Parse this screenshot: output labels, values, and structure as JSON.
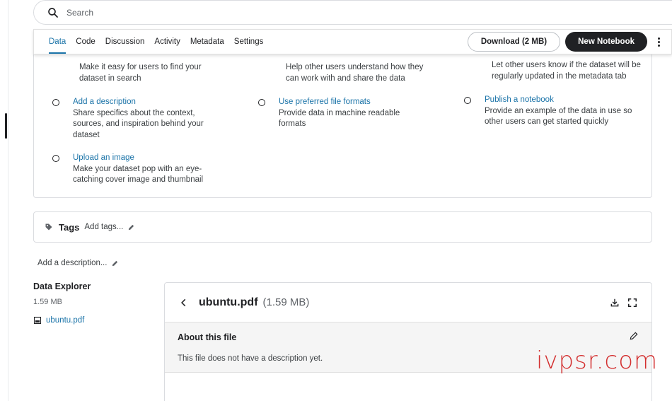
{
  "search": {
    "placeholder": "Search"
  },
  "tabs": [
    {
      "label": "Data",
      "active": true
    },
    {
      "label": "Code"
    },
    {
      "label": "Discussion"
    },
    {
      "label": "Activity"
    },
    {
      "label": "Metadata"
    },
    {
      "label": "Settings"
    }
  ],
  "actions": {
    "download": "Download (2 MB)",
    "new_notebook": "New Notebook"
  },
  "checklist": {
    "col1_top_desc": "Make it easy for users to find your dataset in search",
    "col2_top_desc": "Help other users understand how they can work with and share the data",
    "col3_top_desc": "Let other users know if the dataset will be regularly updated in the metadata tab",
    "items": [
      {
        "title": "Add a description",
        "desc": "Share specifics about the context, sources, and inspiration behind your dataset"
      },
      {
        "title": "Use preferred file formats",
        "desc": "Provide data in machine readable formats"
      },
      {
        "title": "Publish a notebook",
        "desc": "Provide an example of the data in use so other users can get started quickly"
      },
      {
        "title": "Upload an image",
        "desc": "Make your dataset pop with an eye-catching cover image and thumbnail"
      }
    ]
  },
  "tags": {
    "label": "Tags",
    "add": "Add tags..."
  },
  "description": {
    "add": "Add a description..."
  },
  "explorer": {
    "title": "Data Explorer",
    "size": "1.59 MB",
    "file": "ubuntu.pdf"
  },
  "file_panel": {
    "name": "ubuntu.pdf",
    "size": "(1.59 MB)",
    "about_title": "About this file",
    "about_text": "This file does not have a description yet."
  },
  "watermark": "ivpsr.com",
  "colors": {
    "accent": "#1a73a8",
    "dark": "#202124",
    "watermark": "#d32f2f"
  }
}
